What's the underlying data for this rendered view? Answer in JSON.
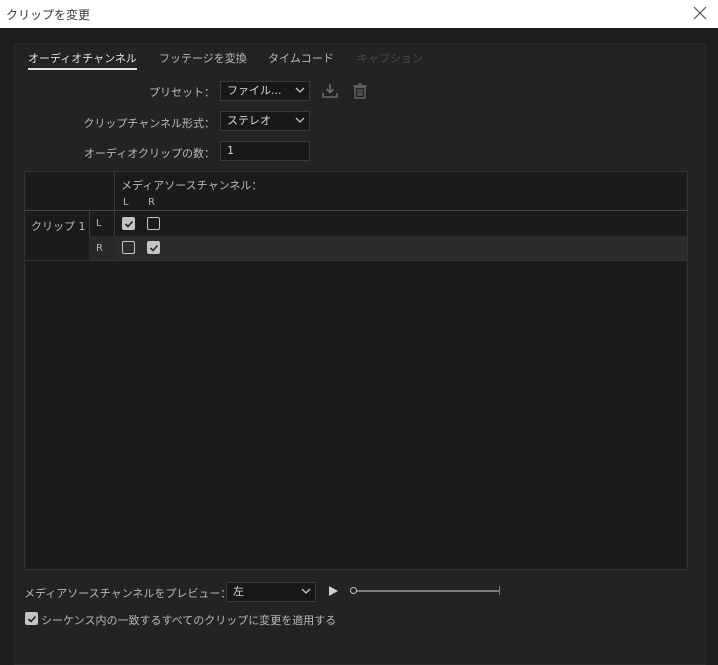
{
  "window": {
    "title": "クリップを変更",
    "close_icon": "close-icon"
  },
  "tabs": [
    {
      "label": "オーディオチャンネル",
      "state": "active"
    },
    {
      "label": "フッテージを変換",
      "state": "normal"
    },
    {
      "label": "タイムコード",
      "state": "normal"
    },
    {
      "label": "キャプション",
      "state": "disabled"
    }
  ],
  "preset": {
    "label": "プリセット：",
    "value": "ファイル...",
    "save_icon": "save-preset-icon",
    "delete_icon": "trash-icon"
  },
  "clip_format": {
    "label": "クリップチャンネル形式：",
    "value": "ステレオ"
  },
  "clip_count": {
    "label": "オーディオクリップの数：",
    "value": "1"
  },
  "grid": {
    "header": "メディアソースチャンネル：",
    "columns": [
      "L",
      "R"
    ],
    "clip_label": "クリップ 1",
    "rows": [
      {
        "label": "L",
        "checks": [
          true,
          false
        ]
      },
      {
        "label": "R",
        "checks": [
          false,
          true
        ]
      }
    ]
  },
  "preview": {
    "label": "メディアソースチャンネルをプレビュー：",
    "value": "左",
    "play_icon": "play-icon",
    "position": 0
  },
  "apply_all": {
    "label": "シーケンス内の一致するすべてのクリップに変更を適用する",
    "checked": true
  },
  "colors": {
    "background": "#1e1e1e",
    "panel": "#232323",
    "field": "#181818",
    "text": "#b9b9b9",
    "disabled_text": "#4b4b4b"
  }
}
